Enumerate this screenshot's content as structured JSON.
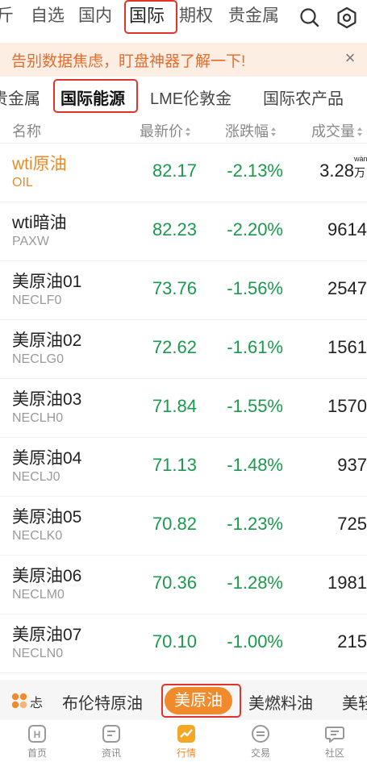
{
  "top_tabs": [
    {
      "label": "斤"
    },
    {
      "label": "自选"
    },
    {
      "label": "国内"
    },
    {
      "label": "国际"
    },
    {
      "label": "期权"
    },
    {
      "label": "贵金属"
    }
  ],
  "top_icons": {
    "search": "search-icon",
    "settings": "settings-icon"
  },
  "banner": {
    "text": "告别数据焦虑，盯盘神器了解一下!",
    "close": "×"
  },
  "sub_tabs": [
    {
      "label": "贵金属"
    },
    {
      "label": "国际能源"
    },
    {
      "label": "LME伦敦金"
    },
    {
      "label": "国际农产品"
    }
  ],
  "columns": {
    "name": "名称",
    "price": "最新价",
    "change": "涨跌幅",
    "volume": "成交量"
  },
  "rows": [
    {
      "name": "wti原油",
      "code": "OIL",
      "price": "82.17",
      "change": "-2.13%",
      "volume": "3.28",
      "unit": "万",
      "unit_py": "wàn"
    },
    {
      "name": "wti暗油",
      "code": "PAXW",
      "price": "82.23",
      "change": "-2.20%",
      "volume": "9614"
    },
    {
      "name": "美原油01",
      "code": "NECLF0",
      "price": "73.76",
      "change": "-1.56%",
      "volume": "2547"
    },
    {
      "name": "美原油02",
      "code": "NECLG0",
      "price": "72.62",
      "change": "-1.61%",
      "volume": "1561"
    },
    {
      "name": "美原油03",
      "code": "NECLH0",
      "price": "71.84",
      "change": "-1.55%",
      "volume": "1570"
    },
    {
      "name": "美原油04",
      "code": "NECLJ0",
      "price": "71.13",
      "change": "-1.48%",
      "volume": "937"
    },
    {
      "name": "美原油05",
      "code": "NECLK0",
      "price": "70.82",
      "change": "-1.23%",
      "volume": "725"
    },
    {
      "name": "美原油06",
      "code": "NECLM0",
      "price": "70.36",
      "change": "-1.28%",
      "volume": "1981"
    },
    {
      "name": "美原油07",
      "code": "NECLN0",
      "price": "70.10",
      "change": "-1.00%",
      "volume": "215"
    }
  ],
  "category_tabs": [
    {
      "label": "布伦特原油"
    },
    {
      "label": "美原油"
    },
    {
      "label": "美燃料油"
    },
    {
      "label": "美轻"
    }
  ],
  "category_partial": "忐",
  "bottom_nav": [
    {
      "label": "首页",
      "icon": "home-icon"
    },
    {
      "label": "资讯",
      "icon": "news-icon"
    },
    {
      "label": "行情",
      "icon": "market-icon"
    },
    {
      "label": "交易",
      "icon": "trade-icon"
    },
    {
      "label": "社区",
      "icon": "community-icon"
    }
  ],
  "colors": {
    "accent": "#ee8a24",
    "down_green": "#1a9a4c",
    "highlight_red": "#e0342b",
    "banner_bg": "#fdeee4"
  }
}
